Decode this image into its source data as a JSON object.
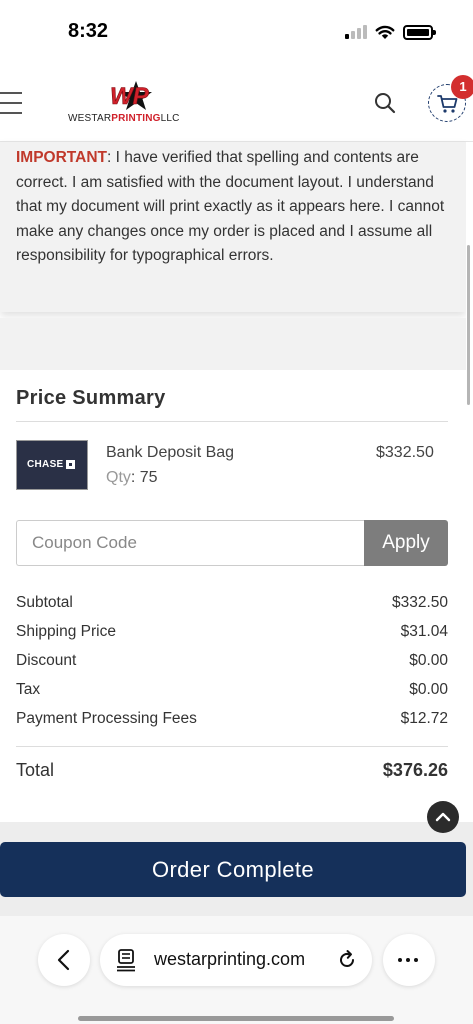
{
  "status_bar": {
    "time": "8:32"
  },
  "header": {
    "logo_mark": "WP",
    "logo_text_prefix": "WESTAR",
    "logo_text_highlight": "PRINTING",
    "logo_text_suffix": "LLC",
    "cart_count": "1"
  },
  "notice": {
    "label": "IMPORTANT",
    "text": ": I have verified that spelling and contents are correct. I am satisfied with the document layout. I understand that my document will print exactly as it appears here. I cannot make any changes once my order is placed and I assume all responsibility for typographical errors."
  },
  "summary": {
    "title": "Price Summary",
    "product": {
      "thumbnail_text": "CHASE",
      "name": "Bank Deposit Bag",
      "qty_label": "Qty",
      "qty_value": ": 75",
      "price": "$332.50"
    },
    "coupon": {
      "placeholder": "Coupon Code",
      "value": "",
      "apply_label": "Apply"
    },
    "rows": [
      {
        "label": "Subtotal",
        "value": "$332.50"
      },
      {
        "label": "Shipping Price",
        "value": "$31.04"
      },
      {
        "label": "Discount",
        "value": "$0.00"
      },
      {
        "label": "Tax",
        "value": "$0.00"
      },
      {
        "label": "Payment Processing Fees",
        "value": "$12.72"
      }
    ],
    "total": {
      "label": "Total",
      "value": "$376.26"
    }
  },
  "order_button": {
    "label": "Order Complete"
  },
  "browser": {
    "url": "westarprinting.com"
  },
  "icons": {
    "menu": "hamburger-menu-icon",
    "search": "search-icon",
    "cart": "cart-icon",
    "scroll_top": "chevron-up-icon",
    "back": "chevron-left-icon",
    "page": "page-icon",
    "reload": "reload-icon",
    "more": "more-icon"
  },
  "colors": {
    "brand_navy": "#15305a",
    "brand_red": "#d0202a",
    "important_red": "#c0392b",
    "badge_red": "#d32f2f",
    "apply_gray": "#7d7d7d"
  }
}
